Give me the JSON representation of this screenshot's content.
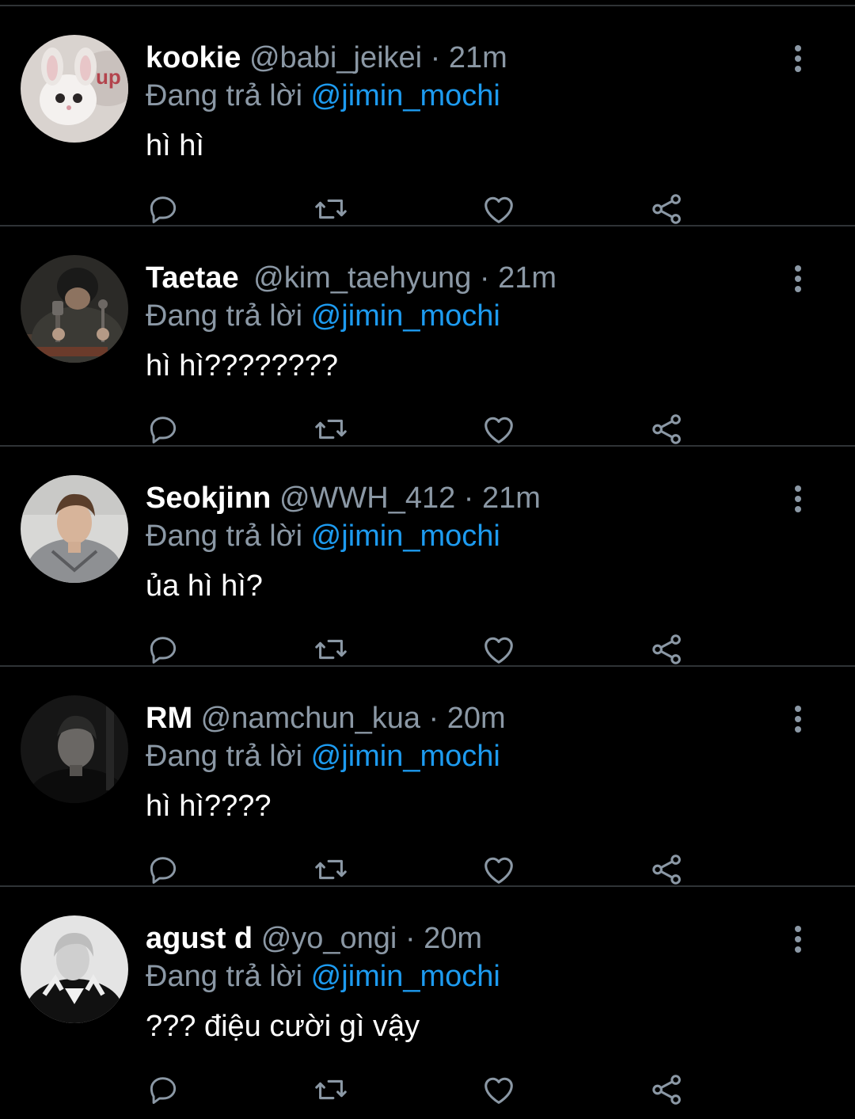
{
  "colors": {
    "background": "#000000",
    "divider": "#2f3336",
    "secondary_text": "#8b98a5",
    "accent": "#1d9bf0",
    "primary_text": "#ffffff"
  },
  "icons": {
    "reply": "speech-bubble-icon",
    "retweet": "retweet-icon",
    "like": "heart-icon",
    "share": "share-icon",
    "more": "more-vertical-icon"
  },
  "separator": "·",
  "tweets": [
    {
      "display_name": "kookie",
      "handle": "@babi_jeikei",
      "time": "21m",
      "reply_prefix": "Đang trả lời",
      "reply_to": "@jimin_mochi",
      "text": "hì hì"
    },
    {
      "display_name": "Taetae",
      "handle": "@kim_taehyung",
      "time": "21m",
      "reply_prefix": "Đang trả lời",
      "reply_to": "@jimin_mochi",
      "text": "hì hì????????"
    },
    {
      "display_name": "Seokjinn",
      "handle": "@WWH_412",
      "time": "21m",
      "reply_prefix": "Đang trả lời",
      "reply_to": "@jimin_mochi",
      "text": "ủa hì hì?"
    },
    {
      "display_name": "RM",
      "handle": "@namchun_kua",
      "time": "20m",
      "reply_prefix": "Đang trả lời",
      "reply_to": "@jimin_mochi",
      "text": "hì hì????"
    },
    {
      "display_name": "agust d",
      "handle": "@yo_ongi",
      "time": "20m",
      "reply_prefix": "Đang trả lời",
      "reply_to": "@jimin_mochi",
      "text": "??? điệu cười gì vậy"
    }
  ]
}
